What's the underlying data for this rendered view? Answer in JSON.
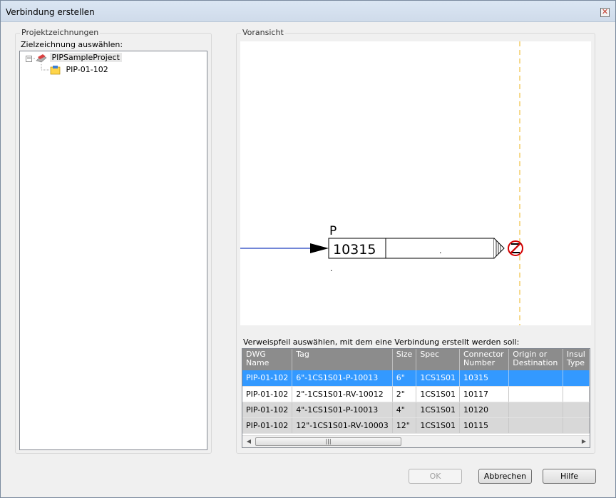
{
  "window": {
    "title": "Verbindung erstellen",
    "close_glyph": "✕"
  },
  "left_panel": {
    "group_title": "Projektzeichnungen",
    "prompt": "Zielzeichnung auswählen:",
    "tree": {
      "expander": "−",
      "root": {
        "label": "PIPSampleProject",
        "icon": "project-icon"
      },
      "children": [
        {
          "label": "PIP-01-102",
          "icon": "drawing-icon"
        }
      ]
    }
  },
  "preview": {
    "group_title": "Voransicht",
    "drawing": {
      "letter": "P",
      "number": "10315",
      "dot": "."
    }
  },
  "connector_table": {
    "prompt": "Verweispfeil auswählen, mit dem eine Verbindung erstellt werden soll:",
    "columns": [
      "DWG Name",
      "Tag",
      "Size",
      "Spec",
      "Connector Number",
      "Origin or Destination",
      "Insul Type"
    ],
    "rows": [
      [
        "PIP-01-102",
        "6\"-1CS1S01-P-10013",
        "6\"",
        "1CS1S01",
        "10315",
        "",
        ""
      ],
      [
        "PIP-01-102",
        "2\"-1CS1S01-RV-10012",
        "2\"",
        "1CS1S01",
        "10117",
        "",
        ""
      ],
      [
        "PIP-01-102",
        "4\"-1CS1S01-P-10013",
        "4\"",
        "1CS1S01",
        "10120",
        "",
        ""
      ],
      [
        "PIP-01-102",
        "12\"-1CS1S01-RV-10003",
        "12\"",
        "1CS1S01",
        "10115",
        "",
        ""
      ]
    ],
    "scrollbar": {
      "left_arrow": "◀",
      "right_arrow": "▶",
      "grip": "|||"
    }
  },
  "buttons": {
    "ok": "OK",
    "cancel": "Abbrechen",
    "help": "Hilfe"
  },
  "colors": {
    "selection": "#3399ff",
    "header": "#8c8c8c",
    "pipe_line": "#1f3fbf",
    "boundary": "#f0c040",
    "symbol_red": "#d40000"
  }
}
